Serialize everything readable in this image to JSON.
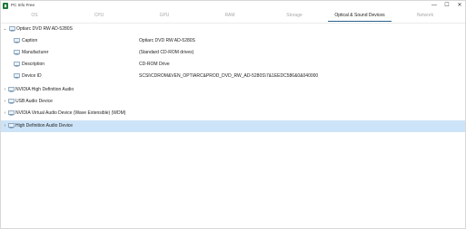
{
  "window": {
    "title": "PC Info Free",
    "controls": {
      "minimize": "—",
      "maximize": "☐",
      "close": "✕"
    }
  },
  "tabs": [
    {
      "label": "OS",
      "active": false
    },
    {
      "label": "CPU",
      "active": false
    },
    {
      "label": "GPU",
      "active": false
    },
    {
      "label": "RAM",
      "active": false
    },
    {
      "label": "Storage",
      "active": false
    },
    {
      "label": "Optical & Sound Devices",
      "active": true
    },
    {
      "label": "Network",
      "active": false
    }
  ],
  "tree": {
    "expanded_device": {
      "name": "Optiarc DVD RW AD-5280S",
      "properties": [
        {
          "label": "Caption",
          "value": "Optiarc DVD RW AD-5280S"
        },
        {
          "label": "Manufacturer",
          "value": "(Standard CD-ROM drives)"
        },
        {
          "label": "Description",
          "value": "CD-ROM Drive"
        },
        {
          "label": "Device ID",
          "value": "SCSI\\CDROM&VEN_OPTIARC&PROD_DVD_RW_AD-5280S\\7&1EEDC586&0&040000"
        }
      ]
    },
    "collapsed_devices": [
      {
        "name": "NVIDIA High Definition Audio",
        "selected": false
      },
      {
        "name": "USB Audio Device",
        "selected": false
      },
      {
        "name": "NVIDIA Virtual Audio Device (Wave Extensible) (WDM)",
        "selected": false
      },
      {
        "name": "High Definition Audio Device",
        "selected": true
      }
    ]
  },
  "colors": {
    "accent": "#2b5f8a",
    "selection": "#cde3f7",
    "app_icon": "#1f7a3d"
  },
  "icons": {
    "expanded": "chevron-down-icon",
    "collapsed": "chevron-right-icon",
    "device": "device-icon"
  }
}
